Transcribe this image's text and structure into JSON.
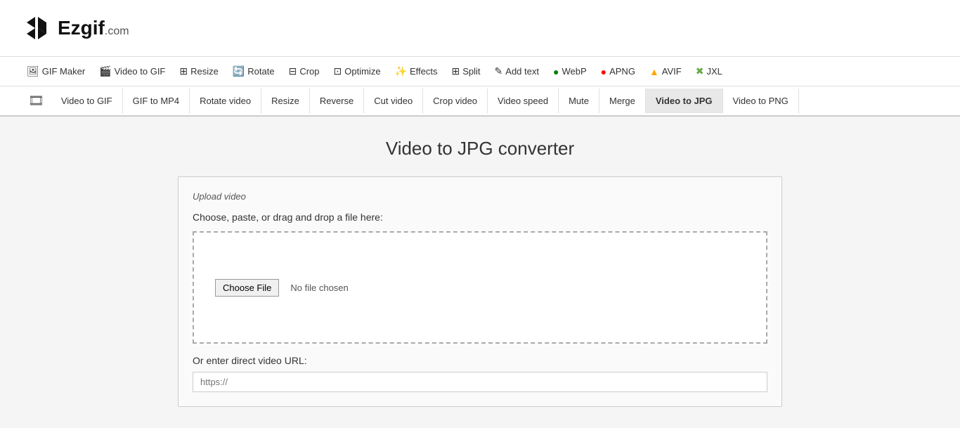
{
  "header": {
    "logo_text": "Ezgif",
    "logo_suffix": ".com"
  },
  "top_nav": {
    "items": [
      {
        "id": "gif-maker",
        "label": "GIF Maker",
        "icon": "🖼"
      },
      {
        "id": "video-to-gif",
        "label": "Video to GIF",
        "icon": "🎬"
      },
      {
        "id": "resize",
        "label": "Resize",
        "icon": "⊞"
      },
      {
        "id": "rotate",
        "label": "Rotate",
        "icon": "🔄"
      },
      {
        "id": "crop",
        "label": "Crop",
        "icon": "⊟"
      },
      {
        "id": "optimize",
        "label": "Optimize",
        "icon": "⊡"
      },
      {
        "id": "effects",
        "label": "Effects",
        "icon": "🌟"
      },
      {
        "id": "split",
        "label": "Split",
        "icon": "⊞"
      },
      {
        "id": "add-text",
        "label": "Add text",
        "icon": "✎"
      },
      {
        "id": "webp",
        "label": "WebP",
        "icon": "🟢"
      },
      {
        "id": "apng",
        "label": "APNG",
        "icon": "🔴"
      },
      {
        "id": "avif",
        "label": "AVIF",
        "icon": "🔶"
      },
      {
        "id": "jxl",
        "label": "JXL",
        "icon": "✖"
      }
    ]
  },
  "sub_nav": {
    "items": [
      {
        "id": "video-to-gif",
        "label": "Video to GIF"
      },
      {
        "id": "gif-to-mp4",
        "label": "GIF to MP4"
      },
      {
        "id": "rotate-video",
        "label": "Rotate video"
      },
      {
        "id": "resize",
        "label": "Resize"
      },
      {
        "id": "reverse",
        "label": "Reverse"
      },
      {
        "id": "cut-video",
        "label": "Cut video"
      },
      {
        "id": "crop-video",
        "label": "Crop video"
      },
      {
        "id": "video-speed",
        "label": "Video speed"
      },
      {
        "id": "mute",
        "label": "Mute"
      },
      {
        "id": "merge",
        "label": "Merge"
      },
      {
        "id": "video-to-jpg",
        "label": "Video to JPG",
        "active": true
      },
      {
        "id": "video-to-png",
        "label": "Video to PNG"
      }
    ]
  },
  "main": {
    "page_title": "Video to JPG converter",
    "upload_section": {
      "box_title": "Upload video",
      "instruction": "Choose, paste, or drag and drop a file here:",
      "choose_file_label": "Choose File",
      "no_file_text": "No file chosen",
      "url_label": "Or enter direct video URL:",
      "url_placeholder": "https://"
    }
  }
}
